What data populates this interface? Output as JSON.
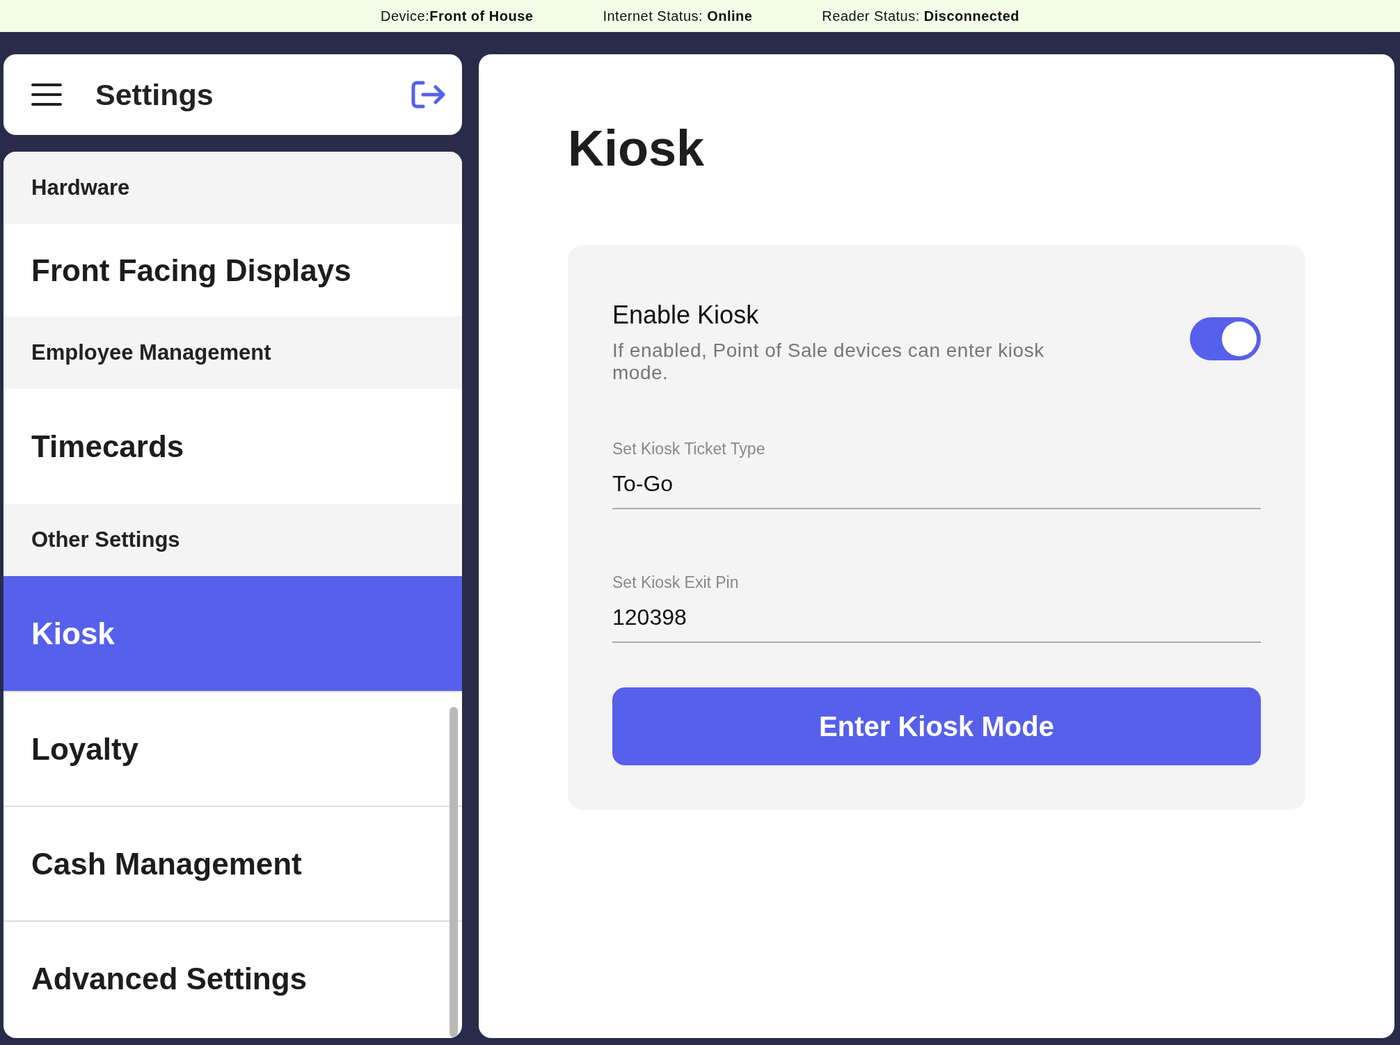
{
  "status_bar": [
    {
      "label": "Device:",
      "value": "Front of House"
    },
    {
      "label": "Internet Status: ",
      "value": "Online"
    },
    {
      "label": "Reader Status: ",
      "value": "Disconnected"
    }
  ],
  "header": {
    "title": "Settings"
  },
  "sidebar": {
    "sections": [
      {
        "title": "Hardware",
        "items": [
          {
            "label": "Front Facing Displays",
            "selected": false
          }
        ]
      },
      {
        "title": "Employee Management",
        "items": [
          {
            "label": "Timecards",
            "selected": false
          }
        ]
      },
      {
        "title": "Other Settings",
        "items": [
          {
            "label": "Kiosk",
            "selected": true
          },
          {
            "label": "Loyalty",
            "selected": false
          },
          {
            "label": "Cash Management",
            "selected": false
          },
          {
            "label": "Advanced Settings",
            "selected": false
          }
        ]
      }
    ]
  },
  "page": {
    "title": "Kiosk",
    "toggle": {
      "label": "Enable Kiosk",
      "description": "If enabled, Point of Sale devices can enter kiosk mode.",
      "on": true
    },
    "fields": [
      {
        "label": "Set Kiosk Ticket Type",
        "value": "To-Go"
      },
      {
        "label": "Set Kiosk Exit Pin",
        "value": "120398"
      }
    ],
    "button": "Enter Kiosk Mode"
  }
}
